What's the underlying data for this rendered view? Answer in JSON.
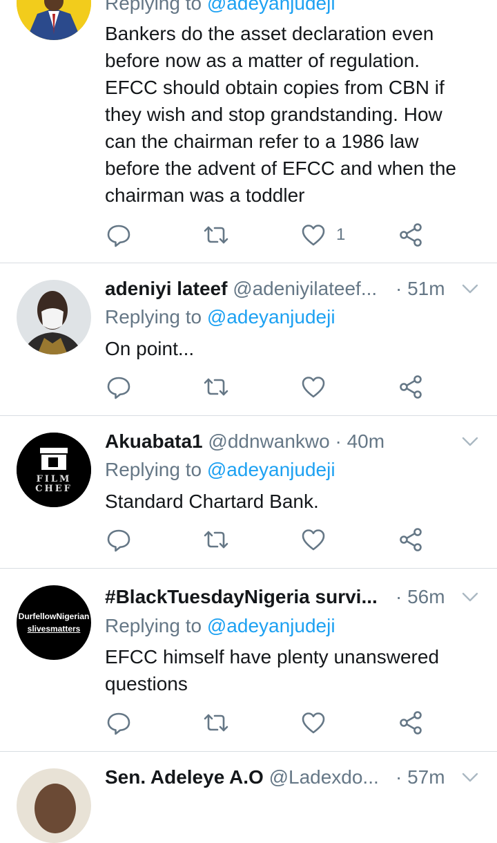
{
  "tweets": [
    {
      "replying_prefix": "Replying to ",
      "replying_handle": "@adeyanjudeji",
      "text_lines": [
        "Bankers do the asset declaration even",
        "before now as a matter of regulation.",
        "EFCC should obtain copies from CBN if",
        "they wish and stop grandstanding. How",
        "can the chairman  refer to a 1986 law",
        "before the advent of EFCC and when the",
        "chairman was a toddler"
      ],
      "like_count": "1"
    },
    {
      "name": "adeniyi lateef",
      "handle": "@adeniyilateef...",
      "time": "· 51m",
      "replying_prefix": "Replying to ",
      "replying_handle": "@adeyanjudeji",
      "text_lines": [
        "On point..."
      ]
    },
    {
      "name": "Akuabata1",
      "handle": "@ddnwankwo",
      "time": "· 40m",
      "replying_prefix": "Replying to ",
      "replying_handle": "@adeyanjudeji",
      "text_lines": [
        "Standard Chartard Bank."
      ],
      "avatar_text_1": "FILM",
      "avatar_text_2": "CHEF"
    },
    {
      "name": "#BlackTuesdayNigeria survi...",
      "handle": "",
      "time": "· 56m",
      "replying_prefix": "Replying to ",
      "replying_handle": "@adeyanjudeji",
      "text_lines": [
        "EFCC himself have plenty unanswered",
        "questions"
      ],
      "avatar_text_1": "Durfellow​Nigerian",
      "avatar_text_2": "slivesmatters"
    },
    {
      "name": "Sen. Adeleye A.O",
      "handle": "@Ladexdo...",
      "time": "· 57m"
    }
  ],
  "colors": {
    "accent": "#1da1f2",
    "secondary": "#657786",
    "divider": "#d8dde2"
  },
  "icons": [
    "reply-icon",
    "retweet-icon",
    "like-icon",
    "share-icon",
    "chevron-down-icon"
  ]
}
